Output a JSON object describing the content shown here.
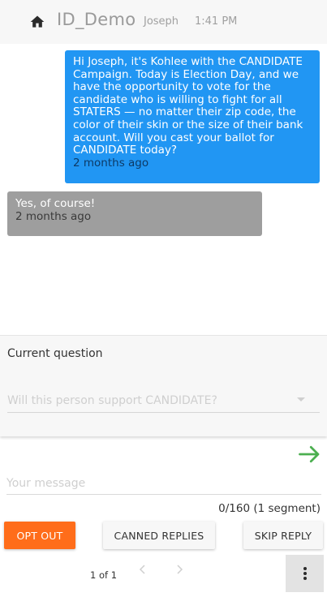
{
  "header": {
    "title": "ID_Demo",
    "contact_name": "Joseph",
    "time": "1:41 PM",
    "icon": "home-icon"
  },
  "messages": [
    {
      "direction": "outgoing",
      "text": "Hi Joseph, it's Kohlee with the CANDIDATE Campaign. Today is Election Day, and we have the opportunity to vote for the candidate who is willing to fight for all STATERS — no matter their zip code, the color of their skin or the size of their bank account. Will you cast your ballot for CANDIDATE today?",
      "time": "2 months ago",
      "color": "#2196f3"
    },
    {
      "direction": "incoming",
      "text": "Yes, of course!",
      "time": "2 months ago",
      "color": "#9e9e9e"
    }
  ],
  "question_panel": {
    "title": "Current question",
    "select_placeholder": "Will this person support CANDIDATE?"
  },
  "composer": {
    "placeholder": "Your message",
    "value": "",
    "char_count": "0/160 (1 segment)",
    "send_icon": "arrow-right-icon",
    "send_color": "#4caf50"
  },
  "actions": {
    "opt_out": "OPT OUT",
    "canned_replies": "CANNED REPLIES",
    "skip_reply": "SKIP REPLY",
    "opt_out_color": "#ff6d1a"
  },
  "pagination": {
    "label": "1 of 1",
    "prev_icon": "chevron-left-icon",
    "next_icon": "chevron-right-icon",
    "more_icon": "more-vertical-icon"
  }
}
